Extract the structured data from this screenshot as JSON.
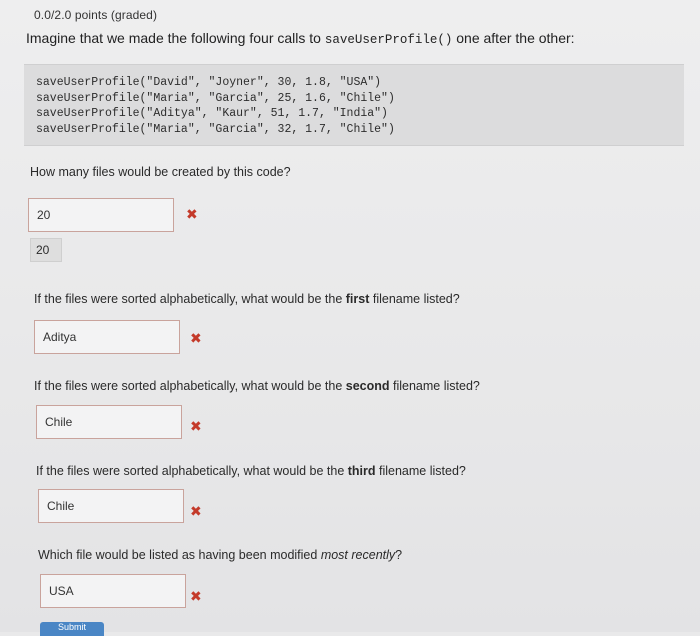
{
  "header": {
    "points": "0.0/2.0 points (graded)"
  },
  "intro": {
    "text_before": "Imagine that we made the following four calls to ",
    "code": "saveUserProfile()",
    "text_after": " one after the other:"
  },
  "code_lines": [
    "saveUserProfile(\"David\", \"Joyner\", 30, 1.8, \"USA\")",
    "saveUserProfile(\"Maria\", \"Garcia\", 25, 1.6, \"Chile\")",
    "saveUserProfile(\"Aditya\", \"Kaur\", 51, 1.7, \"India\")",
    "saveUserProfile(\"Maria\", \"Garcia\", 32, 1.7, \"Chile\")"
  ],
  "q1": {
    "question": "How many files would be created by this code?",
    "answer": "20",
    "given_answer": "20"
  },
  "q2": {
    "pre": "If the files were sorted alphabetically, what would be the ",
    "bold": "first",
    "post": " filename listed?",
    "answer": "Aditya"
  },
  "q3": {
    "pre": "If the files were sorted alphabetically, what would be the ",
    "bold": "second",
    "post": " filename listed?",
    "answer": "Chile"
  },
  "q4": {
    "pre": "If the files were sorted alphabetically, what would be the ",
    "bold": "third",
    "post": " filename listed?",
    "answer": "Chile"
  },
  "q5": {
    "pre": "Which file would be listed as having been modified ",
    "ital": "most recently",
    "post": "?",
    "answer": "USA"
  },
  "status": {
    "incorrect_symbol": "✖"
  },
  "submit": {
    "label": "Submit"
  }
}
